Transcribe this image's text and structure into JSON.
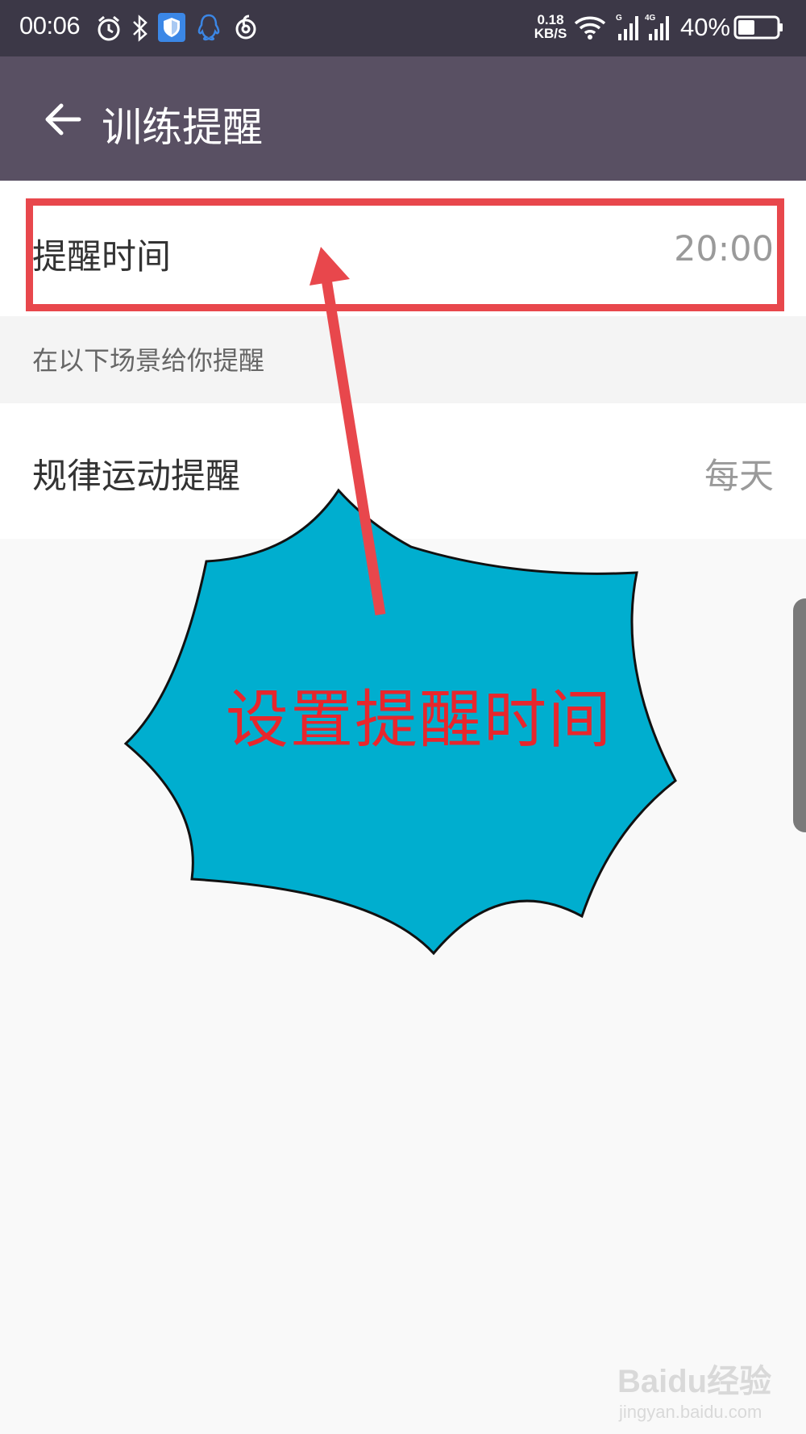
{
  "status_bar": {
    "time": "00:06",
    "net_speed_value": "0.18",
    "net_speed_unit": "KB/S",
    "battery": "40%",
    "icons": [
      "alarm-icon",
      "bluetooth-icon",
      "shield-icon",
      "qq-icon",
      "netease-music-icon",
      "wifi-icon",
      "signal-icon",
      "signal-4g-icon",
      "battery-icon"
    ]
  },
  "header": {
    "back_icon": "arrow-left-icon",
    "title": "训练提醒"
  },
  "settings": {
    "reminder_time": {
      "label": "提醒时间",
      "value": "20:00"
    },
    "section_header": "在以下场景给你提醒",
    "regular_exercise": {
      "label": "规律运动提醒",
      "value": "每天"
    }
  },
  "annotation": {
    "callout_text": "设置提醒时间",
    "callout_color": "#00aecf",
    "arrow_color": "#e8474c",
    "box_color": "#e8474c"
  },
  "watermark": {
    "main": "Baidu经验",
    "sub": "jingyan.baidu.com"
  }
}
